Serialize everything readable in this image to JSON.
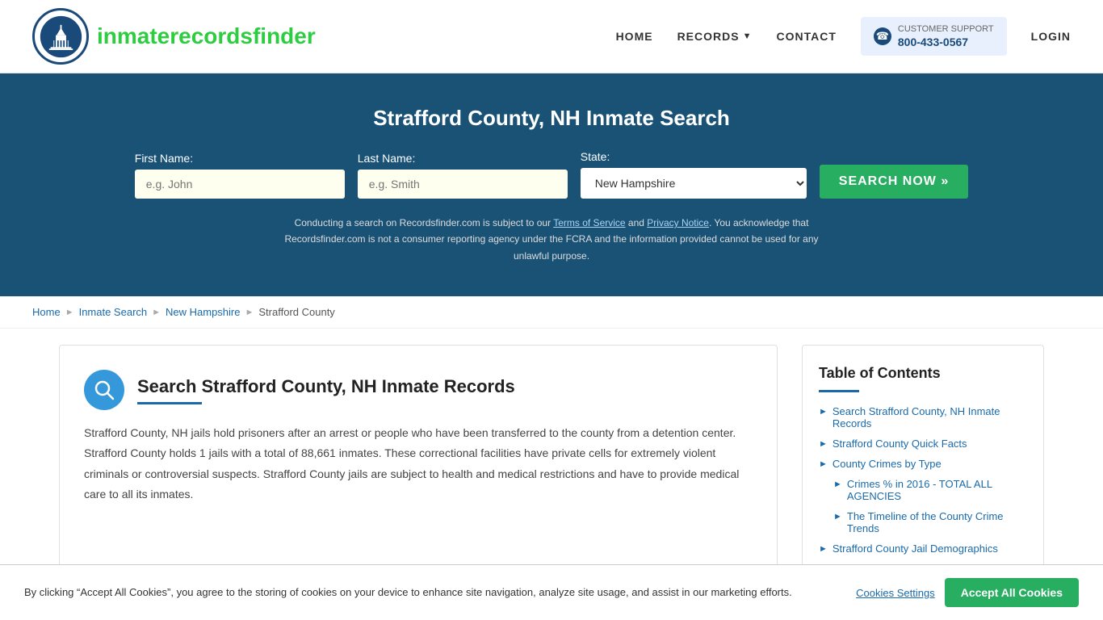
{
  "header": {
    "logo_text_main": "inmaterecords",
    "logo_text_accent": "finder",
    "nav": {
      "home": "HOME",
      "records": "RECORDS",
      "contact": "CONTACT",
      "login": "LOGIN"
    },
    "support": {
      "label": "CUSTOMER SUPPORT",
      "phone": "800-433-0567"
    }
  },
  "hero": {
    "title": "Strafford County, NH Inmate Search",
    "first_name_label": "First Name:",
    "first_name_placeholder": "e.g. John",
    "last_name_label": "Last Name:",
    "last_name_placeholder": "e.g. Smith",
    "state_label": "State:",
    "state_value": "New Hampshire",
    "search_button": "SEARCH NOW »",
    "disclaimer": "Conducting a search on Recordsfinder.com is subject to our Terms of Service and Privacy Notice. You acknowledge that Recordsfinder.com is not a consumer reporting agency under the FCRA and the information provided cannot be used for any unlawful purpose."
  },
  "breadcrumb": {
    "items": [
      "Home",
      "Inmate Search",
      "New Hampshire",
      "Strafford County"
    ]
  },
  "main": {
    "section_title": "Search Strafford County, NH Inmate Records",
    "section_body": "Strafford County, NH jails hold prisoners after an arrest or people who have been transferred to the county from a detention center. Strafford County holds 1 jails with a total of 88,661 inmates. These correctional facilities have private cells for extremely violent criminals or controversial suspects. Strafford County jails are subject to health and medical restrictions and have to provide medical care to all its inmates."
  },
  "toc": {
    "title": "Table of Contents",
    "items": [
      {
        "label": "Search Strafford County, NH Inmate Records",
        "sub": false
      },
      {
        "label": "Strafford County Quick Facts",
        "sub": false
      },
      {
        "label": "County Crimes by Type",
        "sub": false
      },
      {
        "label": "Crimes % in 2016 - TOTAL ALL AGENCIES",
        "sub": true
      },
      {
        "label": "The Timeline of the County Crime Trends",
        "sub": true
      },
      {
        "label": "Strafford County Jail Demographics",
        "sub": false
      }
    ]
  },
  "cookie": {
    "text": "By clicking “Accept All Cookies”, you agree to the storing of cookies on your device to enhance site navigation, analyze site usage, and assist in our marketing efforts.",
    "settings_label": "Cookies Settings",
    "accept_label": "Accept All Cookies"
  }
}
